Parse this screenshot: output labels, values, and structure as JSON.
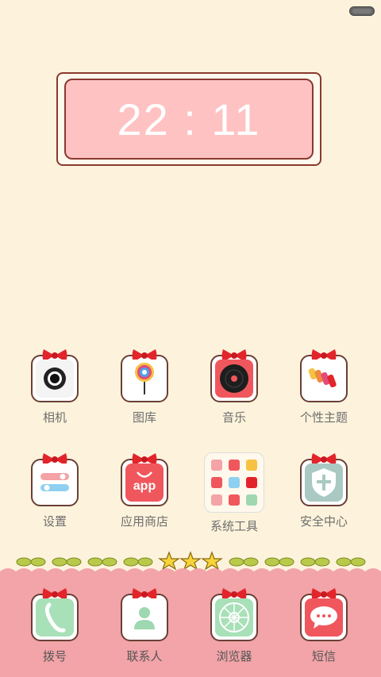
{
  "clock": {
    "time": "22 : 11"
  },
  "apps_row1": [
    {
      "label": "相机",
      "icon": "camera-icon"
    },
    {
      "label": "图库",
      "icon": "gallery-icon"
    },
    {
      "label": "音乐",
      "icon": "music-icon"
    },
    {
      "label": "个性主题",
      "icon": "theme-icon"
    }
  ],
  "apps_row2": [
    {
      "label": "设置",
      "icon": "settings-icon"
    },
    {
      "label": "应用商店",
      "icon": "app-store-icon",
      "badge": "app"
    },
    {
      "label": "系统工具",
      "icon": "system-tools-folder-icon"
    },
    {
      "label": "安全中心",
      "icon": "security-shield-icon"
    }
  ],
  "dock": [
    {
      "label": "拨号",
      "icon": "phone-icon"
    },
    {
      "label": "联系人",
      "icon": "contacts-icon"
    },
    {
      "label": "浏览器",
      "icon": "browser-icon"
    },
    {
      "label": "短信",
      "icon": "messages-icon"
    }
  ],
  "page_indicator": {
    "total": 3,
    "current": 2
  },
  "colors": {
    "background": "#fdf3dc",
    "dock": "#f2a4a8",
    "clock_panel": "#ffc2c2",
    "bow": "#e2252b"
  }
}
